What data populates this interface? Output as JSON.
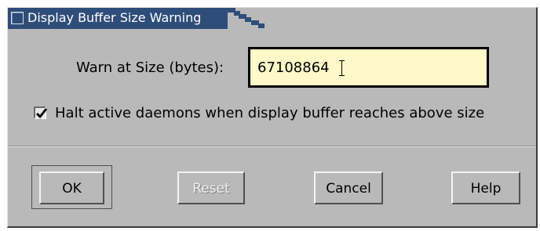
{
  "window": {
    "title": "Display Buffer Size Warning"
  },
  "form": {
    "warn_label": "Warn at Size (bytes):",
    "warn_value": "67108864",
    "halt_label": "Halt active daemons when display buffer reaches above size",
    "halt_checked": true
  },
  "buttons": {
    "ok": "OK",
    "reset": "Reset",
    "cancel": "Cancel",
    "help": "Help"
  },
  "colors": {
    "titlebar": "#2f4d79",
    "dialog_bg": "#b9b9b9",
    "input_bg": "#fff8c8"
  },
  "icons": {
    "title": "window-menu-icon",
    "checkbox": "checkmark-icon",
    "cursor": "text-cursor-icon"
  }
}
